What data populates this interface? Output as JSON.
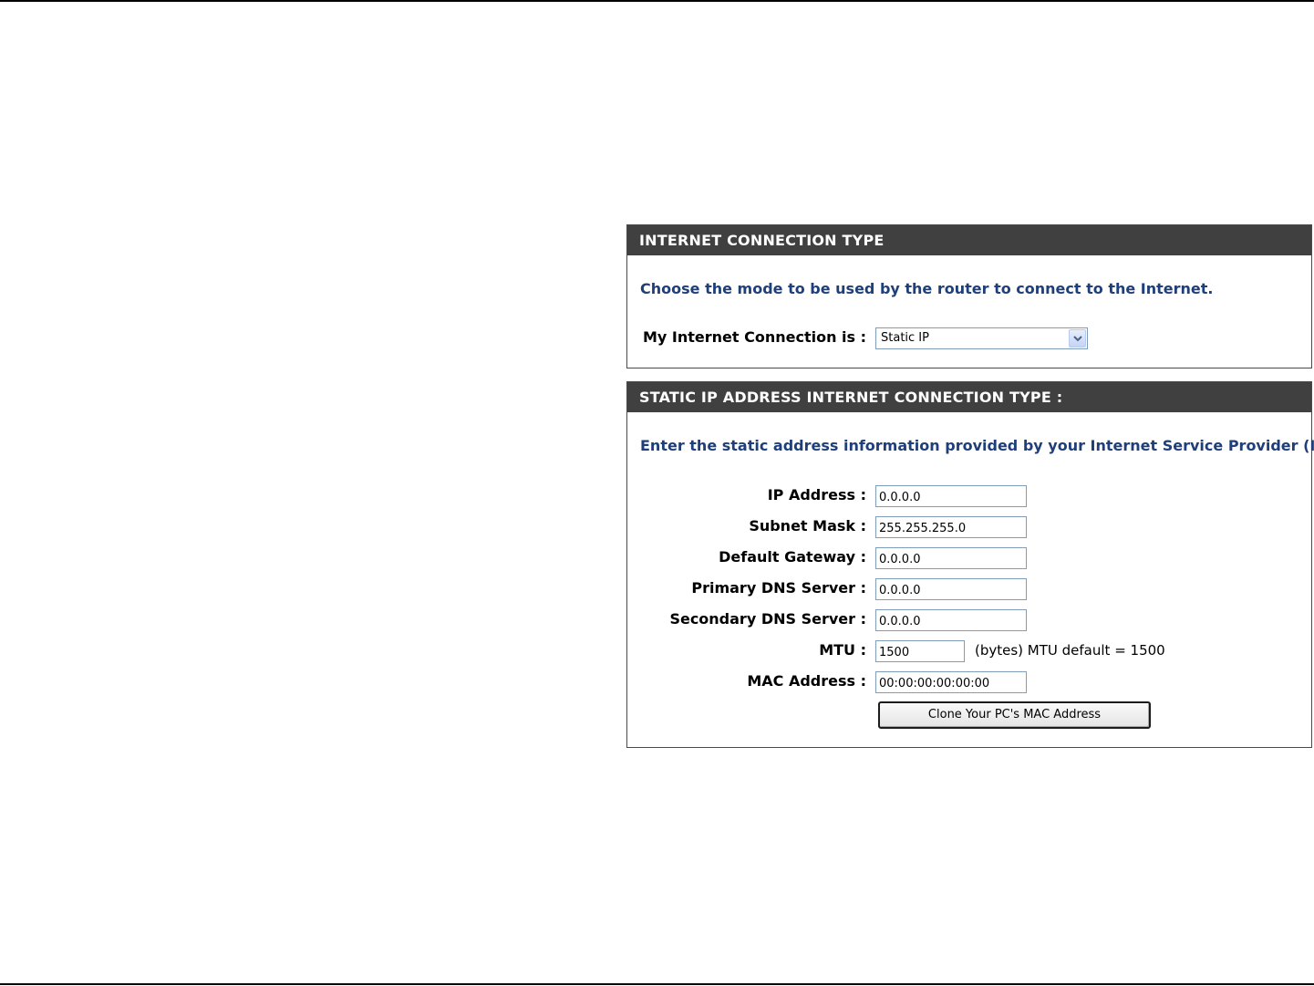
{
  "connection_type": {
    "header": "INTERNET CONNECTION TYPE",
    "description": "Choose the mode to be used by the router to connect to the Internet.",
    "label": "My Internet Connection is :",
    "selected": "Static IP",
    "dropdown_icon": "chevron-down-icon"
  },
  "static_ip": {
    "header": "STATIC IP ADDRESS INTERNET CONNECTION TYPE :",
    "description": "Enter the static address information provided by your Internet Service Provider (ISP).",
    "fields": {
      "ip_address": {
        "label": "IP Address :",
        "value": "0.0.0.0"
      },
      "subnet_mask": {
        "label": "Subnet Mask :",
        "value": "255.255.255.0"
      },
      "default_gateway": {
        "label": "Default Gateway :",
        "value": "0.0.0.0"
      },
      "primary_dns": {
        "label": "Primary DNS Server :",
        "value": "0.0.0.0"
      },
      "secondary_dns": {
        "label": "Secondary DNS Server :",
        "value": "0.0.0.0"
      },
      "mtu": {
        "label": "MTU :",
        "value": "1500",
        "note": "(bytes) MTU default = 1500"
      },
      "mac_address": {
        "label": "MAC Address :",
        "value": "00:00:00:00:00:00"
      }
    },
    "clone_button": "Clone Your PC's MAC Address"
  },
  "colors": {
    "header_bg": "#404040",
    "header_text": "#ffffff",
    "description_text": "#1f3f7a",
    "input_border": "#7f9db9"
  }
}
